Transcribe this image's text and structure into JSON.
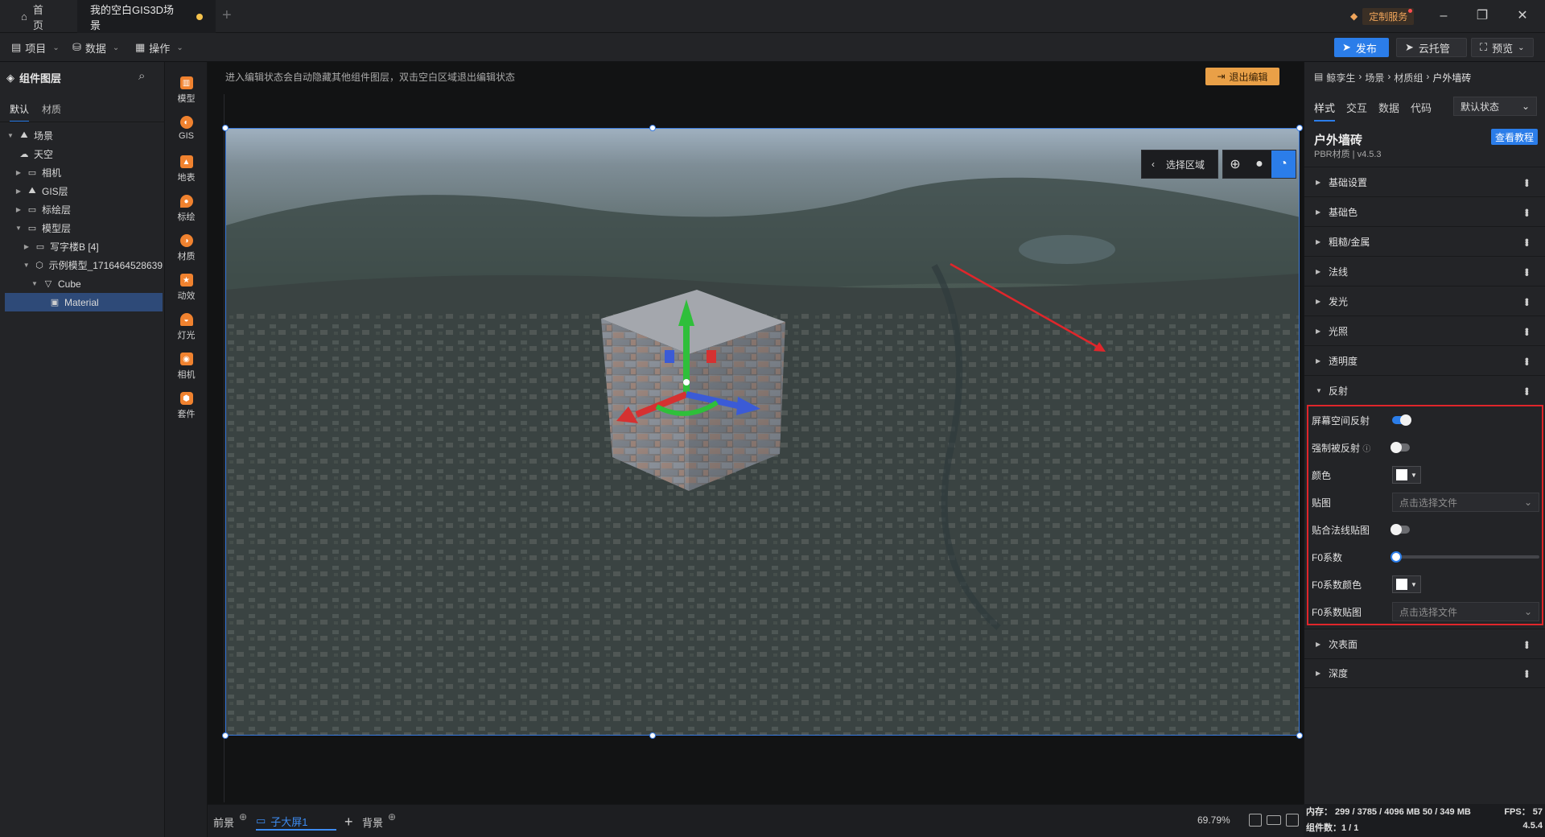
{
  "titlebar": {
    "home_tab": "首页",
    "active_tab": "我的空白GIS3D场景",
    "custom_service": "定制服务"
  },
  "menubar": {
    "items": [
      "项目",
      "数据",
      "操作"
    ],
    "publish": "发布",
    "cloud": "云托管",
    "preview": "预览"
  },
  "layer_panel": {
    "title": "组件图层",
    "tabs": [
      "默认",
      "材质"
    ],
    "tree": [
      {
        "label": "场景",
        "expanded": true
      },
      {
        "label": "天空"
      },
      {
        "label": "相机"
      },
      {
        "label": "GIS层"
      },
      {
        "label": "标绘层"
      },
      {
        "label": "模型层",
        "expanded": true
      },
      {
        "label": "写字楼B [4]"
      },
      {
        "label": "示例模型_1716464528639",
        "expanded": true
      },
      {
        "label": "Cube",
        "expanded": true
      },
      {
        "label": "Material",
        "selected": true
      }
    ]
  },
  "component_toolbar": {
    "items": [
      "模型",
      "GIS",
      "地表",
      "标绘",
      "材质",
      "动效",
      "灯光",
      "相机",
      "套件"
    ]
  },
  "canvas": {
    "hint": "进入编辑状态会自动隐藏其他组件图层，双击空白区域退出编辑状态",
    "exit_edit": "退出编辑",
    "select_area": "选择区域",
    "zoom": "69.79%"
  },
  "bottombar": {
    "front": "前景",
    "screen_tab": "子大屏1",
    "background": "背景"
  },
  "property_panel": {
    "breadcrumb": [
      "鲸孪生",
      "场景",
      "材质组",
      "户外墙砖"
    ],
    "tabs": [
      "样式",
      "交互",
      "数据",
      "代码"
    ],
    "state": "默认状态",
    "material_name": "户外墙砖",
    "material_sub": "PBR材质 | v4.5.3",
    "tutorial": "查看教程",
    "sections_top": [
      "基础设置",
      "基础色",
      "粗糙/金属",
      "法线",
      "发光",
      "光照",
      "透明度",
      "反射"
    ],
    "sections_bottom": [
      "次表面",
      "深度"
    ],
    "reflection": {
      "ssr_label": "屏幕空间反射",
      "ssr_on": true,
      "force_label": "强制被反射",
      "force_on": false,
      "color_label": "颜色",
      "map_label": "贴图",
      "map_placeholder": "点击选择文件",
      "normal_fit_label": "贴合法线贴图",
      "normal_fit_on": false,
      "f0_label": "F0系数",
      "f0_value": 0,
      "f0_color_label": "F0系数颜色",
      "f0_map_label": "F0系数贴图",
      "f0_map_placeholder": "点击选择文件"
    },
    "stats": {
      "memory": "内存： 299 / 3785 / 4096 MB  50 / 349 MB",
      "fps": "FPS：  57",
      "components": "组件数：1 / 1",
      "version": "4.5.4"
    }
  },
  "colors": {
    "accent": "#2b7de9",
    "highlight_box": "#e0262b",
    "exit_button": "#e9a047"
  }
}
